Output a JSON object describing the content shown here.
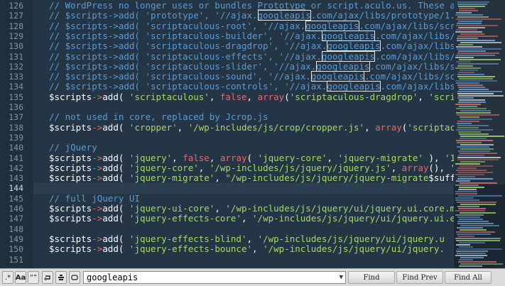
{
  "editor": {
    "gutter_lines": [
      "126",
      "127",
      "128",
      "129",
      "130",
      "131",
      "132",
      "133",
      "134",
      "135",
      "136",
      "137",
      "138",
      "139",
      "140",
      "141",
      "142",
      "143",
      "144",
      "145",
      "146",
      "147",
      "148",
      "149",
      "150",
      "151"
    ],
    "active_line": "144",
    "lines": [
      [
        {
          "t": "// WordPress no longer uses or bundles ",
          "c": "comment"
        },
        {
          "t": "Prototype",
          "c": "comment",
          "u": 1
        },
        {
          "t": " or script.aculo.us. These a",
          "c": "comment"
        }
      ],
      [
        {
          "t": "// $scripts->add( 'prototype', '//ajax.",
          "c": "comment"
        },
        {
          "t": "googleapis",
          "c": "comment",
          "h": 1
        },
        {
          "t": ".com/ajax/libs/prototype/1.",
          "c": "comment"
        }
      ],
      [
        {
          "t": "// $scripts->add( 'scriptaculous-root', '//ajax.",
          "c": "comment"
        },
        {
          "t": "googleapis",
          "c": "comment",
          "h": 1
        },
        {
          "t": ".com/ajax/libs/scr",
          "c": "comment"
        }
      ],
      [
        {
          "t": "// $scripts->add( 'scriptaculous-builder', '//ajax.",
          "c": "comment"
        },
        {
          "t": "googleapis",
          "c": "comment",
          "h": 1
        },
        {
          "t": ".com/ajax/libs/",
          "c": "comment"
        }
      ],
      [
        {
          "t": "// $scripts->add( 'scriptaculous-dragdrop', '//ajax.",
          "c": "comment"
        },
        {
          "t": "googleapis",
          "c": "comment",
          "h": 1
        },
        {
          "t": ".com/ajax/libs",
          "c": "comment"
        }
      ],
      [
        {
          "t": "// $scripts->add( 'scriptaculous-effects', '//ajax.",
          "c": "comment"
        },
        {
          "t": "googleapis",
          "c": "comment",
          "h": 1
        },
        {
          "t": ".com/ajax/libs/",
          "c": "comment"
        }
      ],
      [
        {
          "t": "// $scripts->add( 'scriptaculous-slider', '//ajax.",
          "c": "comment"
        },
        {
          "t": "googleapis",
          "c": "comment",
          "h": 1
        },
        {
          "t": ".com/ajax/libs/s",
          "c": "comment"
        }
      ],
      [
        {
          "t": "// $scripts->add( 'scriptaculous-sound', '//ajax.",
          "c": "comment"
        },
        {
          "t": "googleapis",
          "c": "comment",
          "h": 1
        },
        {
          "t": ".com/ajax/libs/sc",
          "c": "comment"
        }
      ],
      [
        {
          "t": "// $scripts->add( 'scriptaculous-controls', '//ajax.",
          "c": "comment"
        },
        {
          "t": "googleapis",
          "c": "comment",
          "h": 1
        },
        {
          "t": ".com/ajax/libs",
          "c": "comment"
        }
      ],
      [
        {
          "t": "$scripts",
          "c": "var"
        },
        {
          "t": "->",
          "c": "op"
        },
        {
          "t": "add",
          "c": "fn"
        },
        {
          "t": "( ",
          "c": "p"
        },
        {
          "t": "'scriptaculous'",
          "c": "str"
        },
        {
          "t": ", ",
          "c": "p"
        },
        {
          "t": "false",
          "c": "kw"
        },
        {
          "t": ", ",
          "c": "p"
        },
        {
          "t": "array",
          "c": "kw"
        },
        {
          "t": "(",
          "c": "p"
        },
        {
          "t": "'scriptaculous-dragdrop'",
          "c": "str"
        },
        {
          "t": ", ",
          "c": "p"
        },
        {
          "t": "'scri",
          "c": "str"
        }
      ],
      [],
      [
        {
          "t": "// not used in core, replaced by Jcrop.js",
          "c": "comment"
        }
      ],
      [
        {
          "t": "$scripts",
          "c": "var"
        },
        {
          "t": "->",
          "c": "op"
        },
        {
          "t": "add",
          "c": "fn"
        },
        {
          "t": "( ",
          "c": "p"
        },
        {
          "t": "'cropper'",
          "c": "str"
        },
        {
          "t": ", ",
          "c": "p"
        },
        {
          "t": "'/wp-includes/js/crop/cropper.js'",
          "c": "str"
        },
        {
          "t": ", ",
          "c": "p"
        },
        {
          "t": "array",
          "c": "kw"
        },
        {
          "t": "(",
          "c": "p"
        },
        {
          "t": "'scriptac",
          "c": "str"
        }
      ],
      [],
      [
        {
          "t": "// jQuery",
          "c": "comment"
        }
      ],
      [
        {
          "t": "$scripts",
          "c": "var"
        },
        {
          "t": "->",
          "c": "op"
        },
        {
          "t": "add",
          "c": "fn"
        },
        {
          "t": "( ",
          "c": "p"
        },
        {
          "t": "'jquery'",
          "c": "str"
        },
        {
          "t": ", ",
          "c": "p"
        },
        {
          "t": "false",
          "c": "kw"
        },
        {
          "t": ", ",
          "c": "p"
        },
        {
          "t": "array",
          "c": "kw"
        },
        {
          "t": "( ",
          "c": "p"
        },
        {
          "t": "'jquery-core'",
          "c": "str"
        },
        {
          "t": ", ",
          "c": "p"
        },
        {
          "t": "'jquery-migrate'",
          "c": "str"
        },
        {
          "t": " ), ",
          "c": "p"
        },
        {
          "t": "'1",
          "c": "str"
        }
      ],
      [
        {
          "t": "$scripts",
          "c": "var"
        },
        {
          "t": "->",
          "c": "op"
        },
        {
          "t": "add",
          "c": "fn"
        },
        {
          "t": "( ",
          "c": "p"
        },
        {
          "t": "'jquery-core'",
          "c": "str"
        },
        {
          "t": ", ",
          "c": "p"
        },
        {
          "t": "'/wp-includes/js/jquery/jquery.js'",
          "c": "str"
        },
        {
          "t": ", ",
          "c": "p"
        },
        {
          "t": "array",
          "c": "kw"
        },
        {
          "t": "(), ",
          "c": "p"
        },
        {
          "t": "'",
          "c": "str"
        }
      ],
      [
        {
          "t": "$scripts",
          "c": "var"
        },
        {
          "t": "->",
          "c": "op"
        },
        {
          "t": "add",
          "c": "fn"
        },
        {
          "t": "( ",
          "c": "p"
        },
        {
          "t": "'jquery-migrate'",
          "c": "str"
        },
        {
          "t": ", ",
          "c": "p"
        },
        {
          "t": "\"/wp-includes/js/jquery/jquery-migrate",
          "c": "str"
        },
        {
          "t": "$suff",
          "c": "var"
        }
      ],
      [],
      [
        {
          "t": "// full jQuery UI",
          "c": "comment"
        }
      ],
      [
        {
          "t": "$scripts",
          "c": "var"
        },
        {
          "t": "->",
          "c": "op"
        },
        {
          "t": "add",
          "c": "fn"
        },
        {
          "t": "( ",
          "c": "p"
        },
        {
          "t": "'jquery-ui-core'",
          "c": "str"
        },
        {
          "t": ", ",
          "c": "p"
        },
        {
          "t": "'/wp-includes/js/jquery/ui/jquery.ui.core.m",
          "c": "str"
        }
      ],
      [
        {
          "t": "$scripts",
          "c": "var"
        },
        {
          "t": "->",
          "c": "op"
        },
        {
          "t": "add",
          "c": "fn"
        },
        {
          "t": "( ",
          "c": "p"
        },
        {
          "t": "'jquery-effects-core'",
          "c": "str"
        },
        {
          "t": ", ",
          "c": "p"
        },
        {
          "t": "'/wp-includes/js/jquery/ui/jquery.ui.e",
          "c": "str"
        }
      ],
      [],
      [
        {
          "t": "$scripts",
          "c": "var"
        },
        {
          "t": "->",
          "c": "op"
        },
        {
          "t": "add",
          "c": "fn"
        },
        {
          "t": "( ",
          "c": "p"
        },
        {
          "t": "'jquery-effects-blind'",
          "c": "str"
        },
        {
          "t": ", ",
          "c": "p"
        },
        {
          "t": "'/wp-includes/js/jquery/ui/jquery.u",
          "c": "str"
        }
      ],
      [
        {
          "t": "$scripts",
          "c": "var"
        },
        {
          "t": "->",
          "c": "op"
        },
        {
          "t": "add",
          "c": "fn"
        },
        {
          "t": "( ",
          "c": "p"
        },
        {
          "t": "'jquery-effects-bounce'",
          "c": "str"
        },
        {
          "t": ", ",
          "c": "p"
        },
        {
          "t": "'/wp-includes/js/jquery/ui/jquery.",
          "c": "str"
        }
      ]
    ]
  },
  "colors": {
    "background": "#243545",
    "comment": "#5b9bd5",
    "string": "#a6d96a",
    "keyword": "#e06c6c"
  },
  "findbar": {
    "regex_toggle": ".*",
    "case_toggle": "Aa",
    "word_toggle": "“”",
    "wrap_icon": "wrap-icon",
    "selection_icon": "in-selection-icon",
    "highlight_icon": "highlight-icon",
    "query": "googleapis",
    "find_label": "Find",
    "find_prev_label": "Find Prev",
    "find_all_label": "Find All"
  }
}
